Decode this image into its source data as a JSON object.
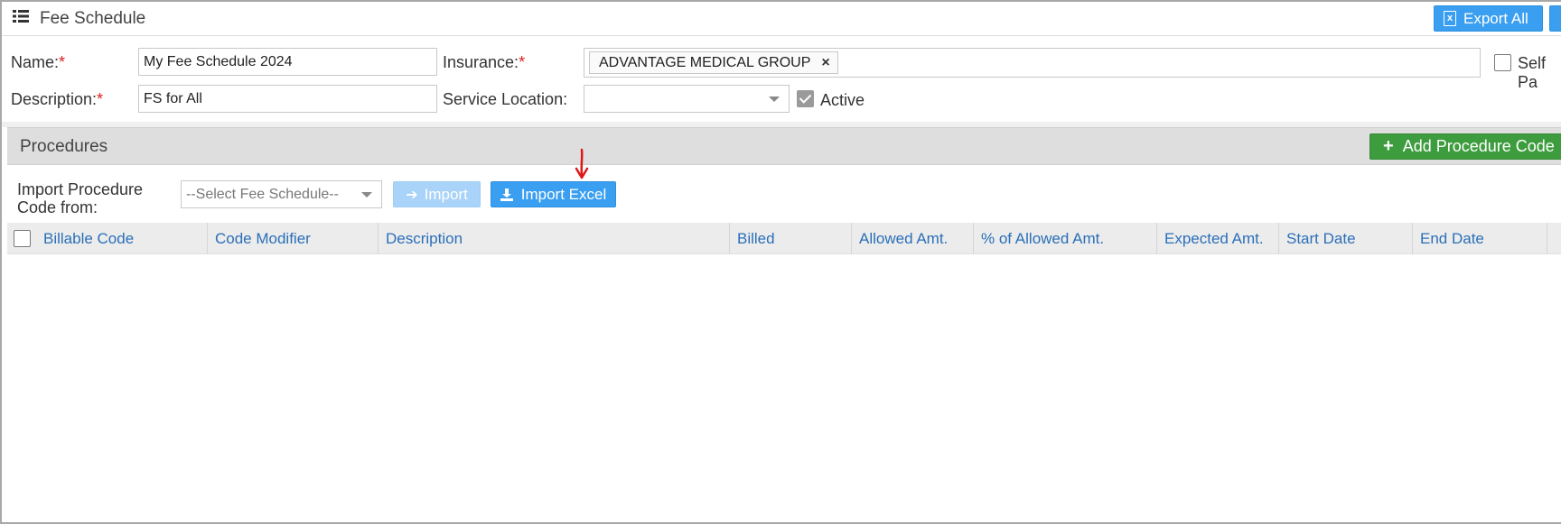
{
  "header": {
    "title": "Fee Schedule",
    "export_label": "Export All",
    "list_icon": "list-icon",
    "export_icon": "excel-icon",
    "play_icon": "play-icon"
  },
  "form": {
    "name_label": "Name:",
    "name_value": "My Fee Schedule 2024",
    "description_label": "Description:",
    "description_value": "FS for All",
    "insurance_label": "Insurance:",
    "insurance_tag": "ADVANTAGE MEDICAL GROUP",
    "insurance_tag_remove": "×",
    "service_location_label": "Service Location:",
    "service_location_value": "",
    "active_label": "Active",
    "active_checked": true,
    "self_pay_label": "Self Pa",
    "required_mark": "*"
  },
  "procedures": {
    "title": "Procedures",
    "add_button_label": "Add Procedure Code",
    "import_from_label_line1": "Import Procedure",
    "import_from_label_line2": "Code from:",
    "fee_schedule_select_placeholder": "--Select Fee Schedule--",
    "import_button_label": "Import",
    "import_excel_button_label": "Import Excel"
  },
  "table": {
    "columns": [
      "Billable Code",
      "Code Modifier",
      "Description",
      "Billed",
      "Allowed Amt.",
      "% of Allowed Amt.",
      "Expected Amt.",
      "Start Date",
      "End Date"
    ]
  },
  "colors": {
    "primary_blue": "#3a9ff0",
    "success_green": "#3d9c3d",
    "link_blue": "#2a6fb8",
    "required_red": "#e02020"
  }
}
